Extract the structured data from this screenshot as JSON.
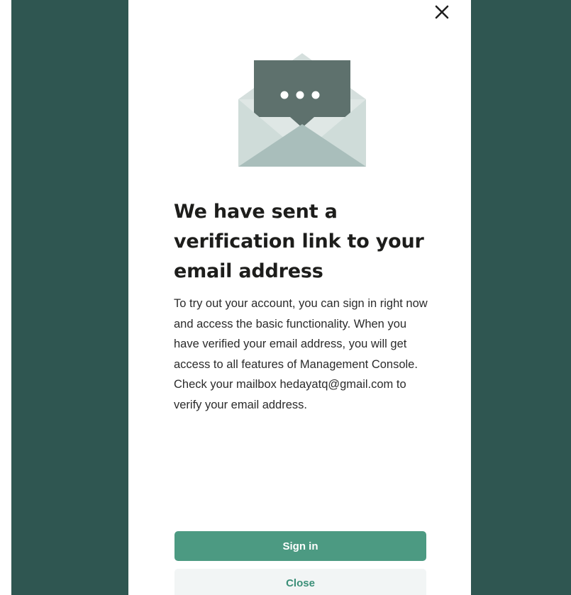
{
  "dialog": {
    "close_icon": "close-icon",
    "illustration_icon": "envelope-message-icon",
    "title": "We have sent a verification link to your email address",
    "body_paragraph_1": "To try out your account, you can sign in right now and access the basic functionality. When you have verified your email address, you will get access to all features of Management Console.",
    "body_paragraph_2": "Check your mailbox hedayatq@gmail.com to verify your email address.",
    "sign_in_label": "Sign in",
    "close_label": "Close"
  },
  "colors": {
    "backdrop": "#2f5651",
    "primary_button": "#4c9a82",
    "primary_button_text": "#ffffff",
    "secondary_button_bg": "#f2f5f5",
    "secondary_button_text": "#3b8f78",
    "title_text": "#1d1d1b"
  }
}
